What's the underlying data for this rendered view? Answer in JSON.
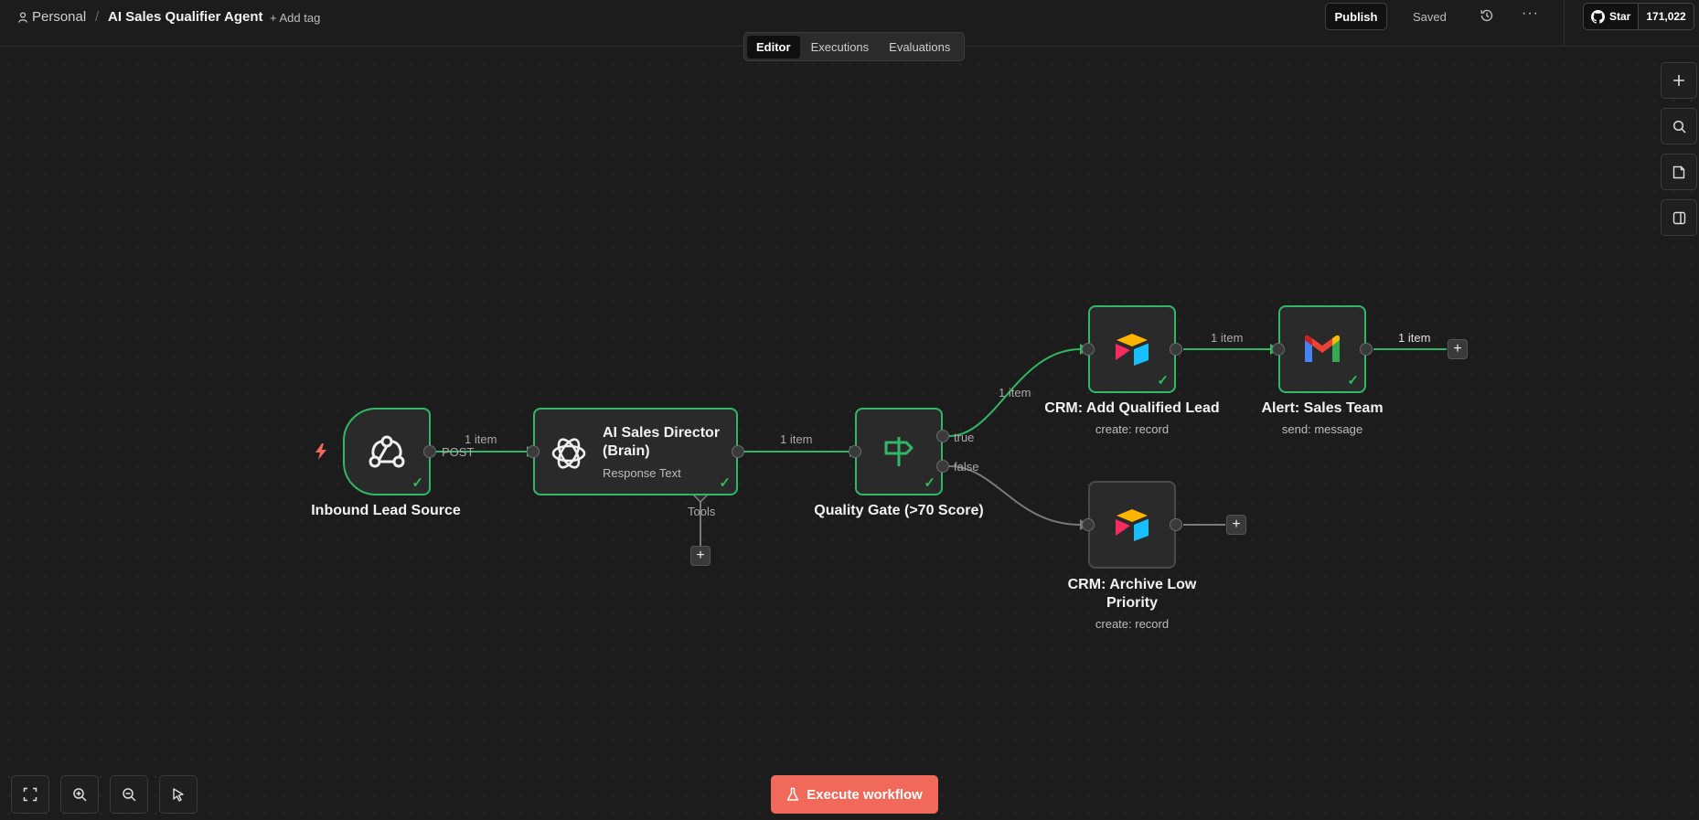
{
  "header": {
    "workspace": "Personal",
    "separator": "/",
    "workflow_title": "AI Sales Qualifier Agent",
    "add_tag": "+ Add tag",
    "publish_label": "Publish",
    "saved_label": "Saved",
    "more_label": "···",
    "github_star_label": "Star",
    "github_star_count": "171,022"
  },
  "tabs": [
    {
      "label": "Editor",
      "active": true
    },
    {
      "label": "Executions",
      "active": false
    },
    {
      "label": "Evaluations",
      "active": false
    }
  ],
  "right_toolbar": [
    "plus-icon",
    "search-icon",
    "sticky-note-icon",
    "panel-icon"
  ],
  "nodes": {
    "inbound": {
      "title": "Inbound Lead Source",
      "icon": "webhook-icon"
    },
    "ai_director": {
      "title_line1": "AI Sales Director",
      "title_line2": "(Brain)",
      "subtitle": "Response Text",
      "tools_label": "Tools",
      "icon": "openai-icon"
    },
    "quality_gate": {
      "title": "Quality Gate (>70 Score)",
      "true_label": "true",
      "false_label": "false",
      "icon": "signpost-icon"
    },
    "crm_add": {
      "title": "CRM: Add Qualified Lead",
      "subtitle": "create: record",
      "icon": "airtable-icon"
    },
    "alert": {
      "title": "Alert: Sales Team",
      "subtitle": "send: message",
      "icon": "gmail-icon"
    },
    "crm_archive": {
      "title_line1": "CRM: Archive Low",
      "title_line2": "Priority",
      "subtitle": "create: record",
      "icon": "airtable-icon"
    }
  },
  "edges": {
    "post_label": "POST",
    "item_label": "1 item"
  },
  "bottom": {
    "execute_label": "Execute workflow",
    "tools": [
      "fit-view-icon",
      "zoom-in-icon",
      "zoom-out-icon",
      "tidy-up-icon"
    ]
  },
  "colors": {
    "accent_green": "#31b866",
    "execute_button": "#f0695a",
    "trigger_bolt": "#f0695a"
  }
}
